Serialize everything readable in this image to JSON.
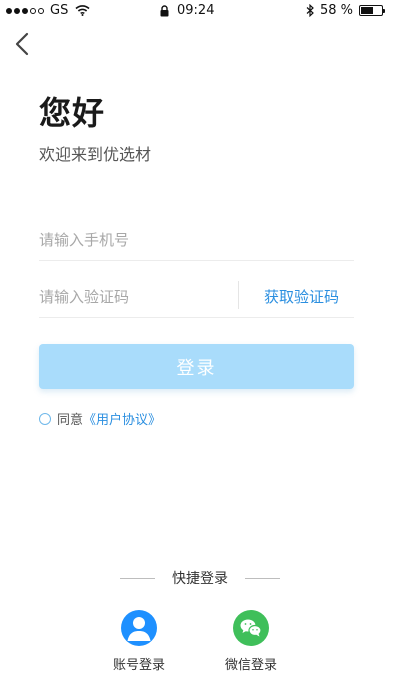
{
  "status_bar": {
    "carrier": "GS",
    "time": "09:24",
    "battery": "58 %",
    "battery_fraction": 0.58
  },
  "header": {
    "title": "您好",
    "subtitle": "欢迎来到优选材"
  },
  "form": {
    "phone_placeholder": "请输入手机号",
    "code_placeholder": "请输入验证码",
    "get_code_label": "获取验证码",
    "login_label": "登录"
  },
  "agreement": {
    "agree_text": "同意",
    "link_text": "《用户协议》"
  },
  "quick_login": {
    "title": "快捷登录",
    "account_label": "账号登录",
    "wechat_label": "微信登录"
  },
  "colors": {
    "accent": "#2b8fe0",
    "login_button": "#a9dcfb",
    "account_icon": "#1e90ff",
    "wechat_icon": "#3fbf5a"
  },
  "icons": {
    "back": "chevron-left-icon",
    "wifi": "wifi-icon",
    "lock": "lock-icon",
    "bluetooth": "bluetooth-icon",
    "battery": "battery-icon",
    "account": "user-icon",
    "wechat": "wechat-icon"
  }
}
